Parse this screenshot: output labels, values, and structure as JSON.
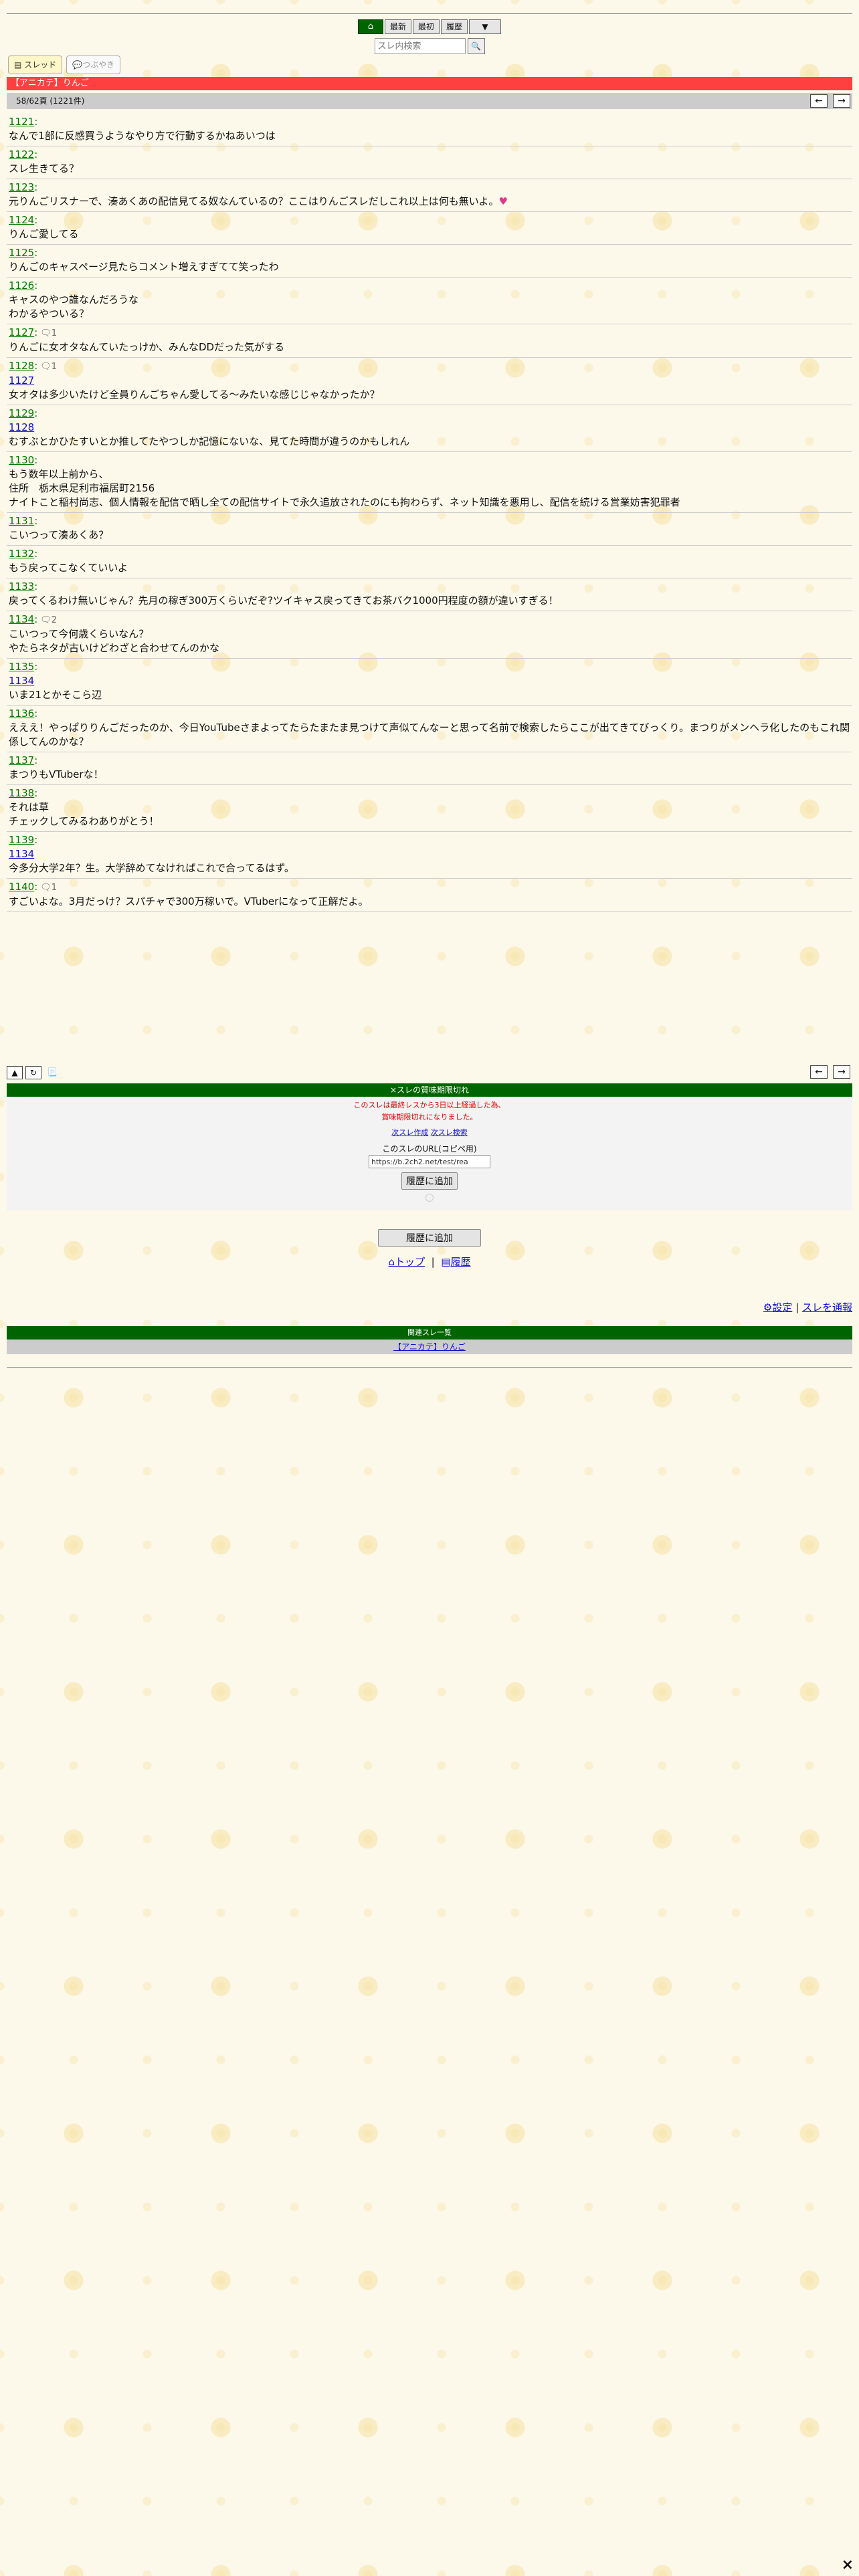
{
  "nav": {
    "home_icon": "home-icon",
    "latest": "最新",
    "first": "最初",
    "history": "履歴",
    "more": "▼"
  },
  "search": {
    "placeholder": "スレ内検索",
    "icon": "search-icon"
  },
  "tabs": {
    "thread": "スレッド",
    "tsubuyaki": "つぶやき"
  },
  "thread": {
    "title": "【アニカテ】りんご",
    "page_info": "58/62頁 (1221件)"
  },
  "posts": [
    {
      "num": "1121",
      "text": "なんで1部に反感買うようなやり方で行動するかねあいつは"
    },
    {
      "num": "1122",
      "text": "スレ生きてる？"
    },
    {
      "num": "1123",
      "text": "元りんごリスナーで、湊あくあの配信見てる奴なんているの？ここはりんごスレだしこれ以上は何も無いよ。",
      "heart": "♥"
    },
    {
      "num": "1124",
      "text": "りんご愛してる"
    },
    {
      "num": "1125",
      "text": "りんごのキャスページ見たらコメント増えすぎてて笑ったわ"
    },
    {
      "num": "1126",
      "text": "キャスのやつ誰なんだろうな",
      "text2": "わかるやついる？"
    },
    {
      "num": "1127",
      "rc": "1",
      "text": "りんごに女オタなんていたっけか、みんなDDだった気がする"
    },
    {
      "num": "1128",
      "rc": "1",
      "reply": "1127",
      "text": "女オタは多少いたけど全員りんごちゃん愛してる〜みたいな感じじゃなかったか？"
    },
    {
      "num": "1129",
      "reply": "1128",
      "text": "むすぶとかひたすいとか推してたやつしか記憶にないな、見てた時間が違うのかもしれん"
    },
    {
      "num": "1130",
      "text": "もう数年以上前から、",
      "text2": "住所　栃木県足利市福居町2156",
      "text3": "ナイトこと稲村尚志、個人情報を配信で晒し全ての配信サイトで永久追放されたのにも拘わらず、ネット知識を悪用し、配信を続ける営業妨害犯罪者"
    },
    {
      "num": "1131",
      "text": "こいつって湊あくあ？"
    },
    {
      "num": "1132",
      "text": "もう戻ってこなくていいよ"
    },
    {
      "num": "1133",
      "text": "戻ってくるわけ無いじゃん？先月の稼ぎ300万くらいだぞ?ツイキャス戻ってきてお茶バク1000円程度の額が違いすぎる！"
    },
    {
      "num": "1134",
      "rc": "2",
      "text": "こいつって今何歳くらいなん？",
      "text2": "やたらネタが古いけどわざと合わせてんのかな"
    },
    {
      "num": "1135",
      "reply": "1134",
      "text": "いま21とかそこら辺"
    },
    {
      "num": "1136",
      "text": "えええ！やっぱりりんごだったのか、今日YouTubeさまよってたらたまたま見つけて声似てんなーと思って名前で検索したらここが出てきてびっくり。まつりがメンヘラ化したのもこれ関係してんのかな？"
    },
    {
      "num": "1137",
      "text": "まつりもVTuberな！"
    },
    {
      "num": "1138",
      "text": "それは草",
      "text2": "チェックしてみるわありがとう！"
    },
    {
      "num": "1139",
      "reply": "1134",
      "text": "今多分大学2年？生。大学辞めてなければこれで合ってるはず。"
    },
    {
      "num": "1140",
      "rc": "1",
      "text": "すごいよな。3月だっけ？スパチャで300万稼いで。VTuberになって正解だよ。"
    }
  ],
  "notice": {
    "header": "×スレの質味期限切れ",
    "line1": "このスレは最終レスから3日以上経過した為、",
    "line2": "賞味期限切れになりました。",
    "link1": "次スレ作成",
    "link2": "次スレ検索",
    "url_label": "このスレのURL(コピペ用)",
    "url_value": "https://b.2ch2.net/test/rea",
    "add_history": "履歴に追加"
  },
  "bottom": {
    "add_history": "履歴に追加",
    "top_link": "トップ",
    "sep": "|",
    "history_link": "履歴",
    "settings": "設定",
    "report": "スレを通報"
  },
  "related": {
    "header": "関連スレ一覧",
    "item": "【アニカテ】りんご"
  },
  "close": "×"
}
